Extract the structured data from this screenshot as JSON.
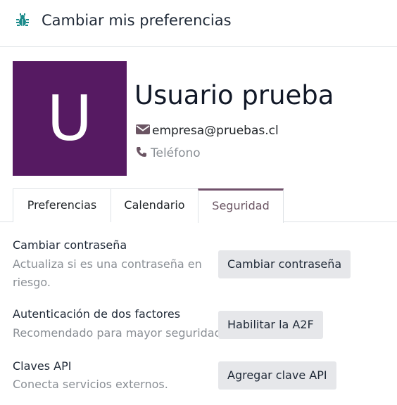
{
  "header": {
    "icon": "bug-icon",
    "title": "Cambiar mis preferencias"
  },
  "profile": {
    "avatar_letter": "U",
    "avatar_color": "#561a62",
    "name": "Usuario prueba",
    "email": "empresa@pruebas.cl",
    "phone_placeholder": "Teléfono",
    "email_icon": "envelope-icon",
    "phone_icon": "phone-icon"
  },
  "tabs": [
    {
      "label": "Preferencias",
      "active": false
    },
    {
      "label": "Calendario",
      "active": false
    },
    {
      "label": "Seguridad",
      "active": true
    }
  ],
  "security": {
    "password": {
      "title": "Cambiar contraseña",
      "description": "Actualiza si es una contraseña en riesgo.",
      "button": "Cambiar contraseña"
    },
    "two_factor": {
      "title": "Autenticación de dos factores",
      "description": "Recomendado para mayor seguridad.",
      "button": "Habilitar la A2F"
    },
    "api_keys": {
      "title": "Claves API",
      "description": "Conecta servicios externos.",
      "button": "Agregar clave API"
    }
  },
  "colors": {
    "accent": "#71516b",
    "header_icon": "#1a8a8a",
    "button_bg": "#e6e7ea"
  }
}
